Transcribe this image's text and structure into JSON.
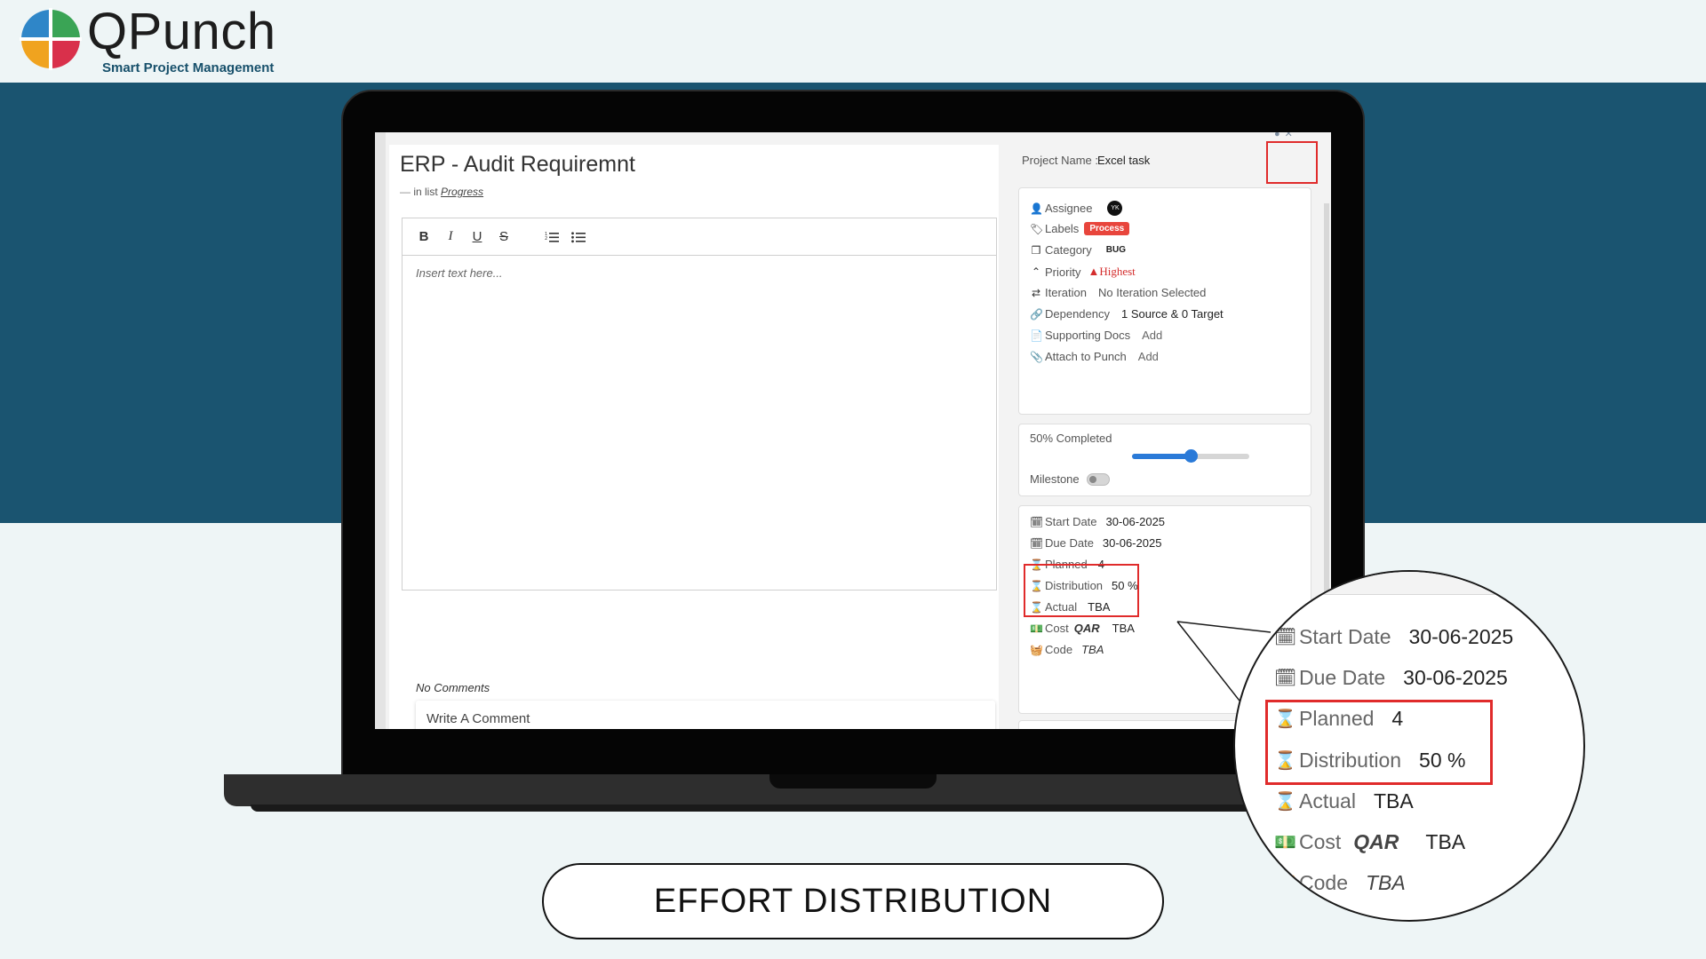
{
  "brand": {
    "name": "QPunch",
    "tagline": "Smart Project Management",
    "colors": {
      "teal": "#1a5470",
      "green": "#3aa455",
      "blue": "#2f86c8",
      "orange": "#f0a31f",
      "red": "#d9304b"
    }
  },
  "task": {
    "title": "ERP - Audit Requiremnt",
    "in_list_prefix": "in list",
    "list_name": "Progress",
    "editor": {
      "toolbar": [
        "bold-icon",
        "italic-icon",
        "underline-icon",
        "strikethrough-icon",
        "ordered-list-icon",
        "bullet-list-icon"
      ],
      "placeholder": "Insert text here..."
    },
    "comments": {
      "empty_label": "No Comments",
      "input_placeholder": "Write A Comment"
    }
  },
  "details": {
    "project_name_label": "Project Name :",
    "project_name": "Excel task",
    "assignee_label": "Assignee",
    "assignee_initials": "YK",
    "labels_label": "Labels",
    "label_chip": "Process",
    "category_label": "Category",
    "category_value": "BUG",
    "priority_label": "Priority",
    "priority_value": "Highest",
    "iteration_label": "Iteration",
    "iteration_value": "No Iteration Selected",
    "dependency_label": "Dependency",
    "dependency_value": "1 Source & 0 Target",
    "supporting_docs_label": "Supporting Docs",
    "supporting_docs_value": "Add",
    "attach_label": "Attach to Punch",
    "attach_value": "Add",
    "completed_label": "50% Completed",
    "completed_fraction": 0.5,
    "milestone_label": "Milestone",
    "milestone_on": false,
    "start_date_label": "Start Date",
    "start_date": "30-06-2025",
    "due_date_label": "Due Date",
    "due_date": "30-06-2025",
    "planned_label": "Planned",
    "planned_value": "4",
    "distribution_label": "Distribution",
    "distribution_value": "50 %",
    "actual_label": "Actual",
    "actual_value": "TBA",
    "cost_label": "Cost",
    "cost_currency": "QAR",
    "cost_value": "TBA",
    "code_label": "Code",
    "code_value": "TBA"
  },
  "caption": "EFFORT DISTRIBUTION"
}
